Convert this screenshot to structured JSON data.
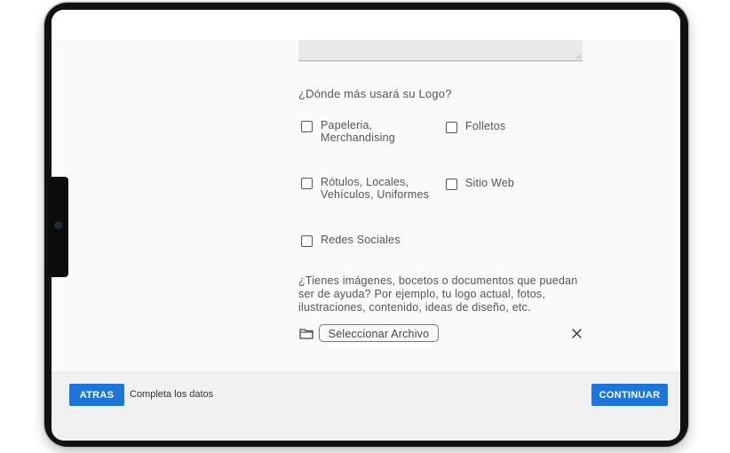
{
  "form": {
    "question_logo_usage": "¿Dónde más usará su Logo?",
    "options": [
      {
        "label_line1": "Papeleria,",
        "label_line2": "Merchandising",
        "checked": false
      },
      {
        "label_line1": "Folletos",
        "label_line2": "",
        "checked": false
      },
      {
        "label_line1": "Rótulos, Locales,",
        "label_line2": "Vehículos, Uniformes",
        "checked": false
      },
      {
        "label_line1": "Sitio Web",
        "label_line2": "",
        "checked": false
      },
      {
        "label_line1": "Redes Sociales",
        "label_line2": "",
        "checked": false
      }
    ],
    "question_files_line1": "¿Tienes imágenes, bocetos o documentos que puedan",
    "question_files_line2": "ser de ayuda? Por ejemplo, tu logo actual, fotos,",
    "question_files_line3": "ilustraciones, contenido, ideas de diseño, etc.",
    "file_button_label": "Seleccionar Archivo",
    "folder_icon": "folder-icon",
    "clear_icon": "close-icon"
  },
  "footer": {
    "back_label": "ATRAS",
    "status_text": "Completa los datos",
    "continue_label": "CONTINUAR"
  },
  "colors": {
    "primary_button": "#1f74d8",
    "text": "#555555",
    "footer_bg": "#f0f0f0",
    "device_frame": "#111111"
  }
}
